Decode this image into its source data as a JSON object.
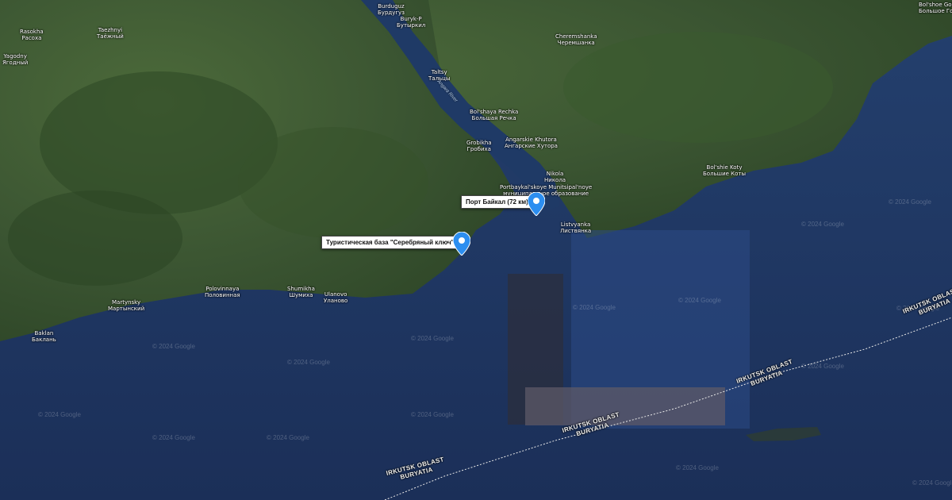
{
  "map": {
    "watermark": "© 2024 Google",
    "river_label": "Angara River",
    "places": [
      {
        "id": "burduguz",
        "latin": "Burduguz",
        "cyrillic": "Бурдугуз"
      },
      {
        "id": "bugurk",
        "latin": "Buryk-P",
        "cyrillic": "Бутыркил"
      },
      {
        "id": "rasokha",
        "latin": "Rasokha",
        "cyrillic": "Расоха"
      },
      {
        "id": "taezhnyi",
        "latin": "Taezhnyi",
        "cyrillic": "Таёжный"
      },
      {
        "id": "yagodny",
        "latin": "Yagodny",
        "cyrillic": "Ягодный"
      },
      {
        "id": "taltsy",
        "latin": "Taltsy",
        "cyrillic": "Тальцы"
      },
      {
        "id": "cheremshanka",
        "latin": "Cheremshanka",
        "cyrillic": "Черемшанка"
      },
      {
        "id": "bolshaya_rechka",
        "latin": "Bol'shaya Rechka",
        "cyrillic": "Большая Речка"
      },
      {
        "id": "grobikha",
        "latin": "Grobikha",
        "cyrillic": "Гробиха"
      },
      {
        "id": "angarskie",
        "latin": "Angarskie Khutora",
        "cyrillic": "Ангарские Хутора"
      },
      {
        "id": "nikola",
        "latin": "Nikola",
        "cyrillic": "Никола"
      },
      {
        "id": "portbaikal",
        "latin": "Portbaykal'skoye Munitsipal'noye",
        "cyrillic": "муниципальное образование"
      },
      {
        "id": "listvyanka",
        "latin": "Listvyanka",
        "cyrillic": "Листвянка"
      },
      {
        "id": "bolshie_koty",
        "latin": "Bol'shie Koty",
        "cyrillic": "Большие Коты"
      },
      {
        "id": "polovinnaya",
        "latin": "Polovinnaya",
        "cyrillic": "Половинная"
      },
      {
        "id": "shumikha",
        "latin": "Shumikha",
        "cyrillic": "Шумиха"
      },
      {
        "id": "ulanovo",
        "latin": "Ulanovo",
        "cyrillic": "Уланово"
      },
      {
        "id": "martynsky",
        "latin": "Martynsky",
        "cyrillic": "Мартынский"
      },
      {
        "id": "baklan",
        "latin": "Baklan",
        "cyrillic": "Баклань"
      },
      {
        "id": "bolshoe_goloustnoe",
        "latin": "Bol'shoe Goloustnoe",
        "cyrillic": "Большое Голоустное"
      }
    ],
    "boundaries": [
      {
        "region": "IRKUTSK OBLAST",
        "neighbor": "BURYATIA"
      },
      {
        "region": "IRKUTSK OBLAST",
        "neighbor": "BURYATIA"
      },
      {
        "region": "IRKUTSK OBLAST",
        "neighbor": "BURYATIA"
      },
      {
        "region": "IRKUTSK OBLAST",
        "neighbor": "BURYATIA"
      }
    ],
    "markers": [
      {
        "label": "Порт Байкал (72 км)",
        "color": "#2c8ef0"
      },
      {
        "label": "Туристическая база \"Серебряный ключ\"",
        "color": "#2c8ef0"
      }
    ],
    "colors": {
      "land": "#3d5a32",
      "water": "#1f3660",
      "pin": "#2c8ef0"
    }
  }
}
